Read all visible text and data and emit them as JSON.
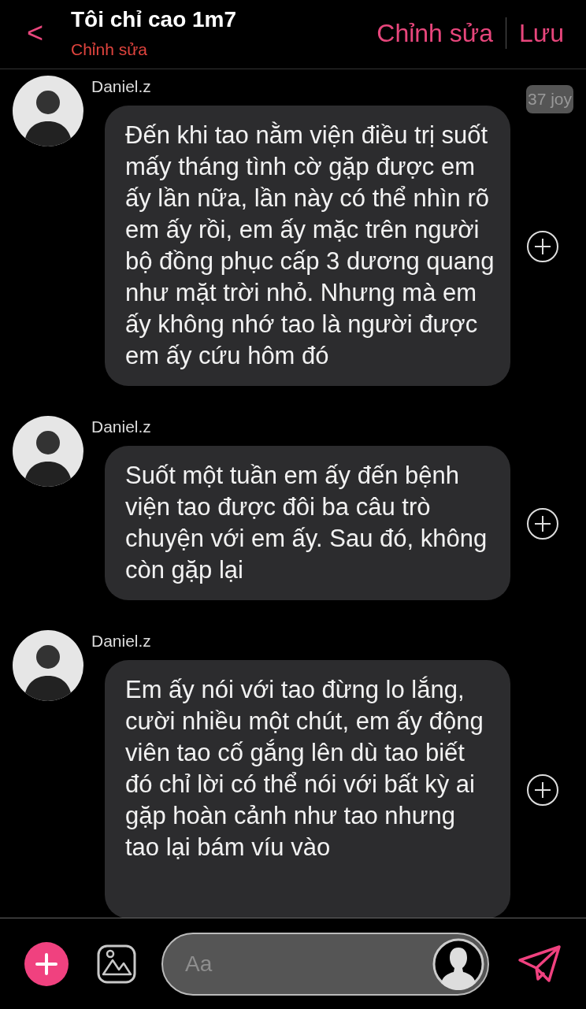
{
  "header": {
    "back": "<",
    "title": "Tôi chỉ cao 1m7",
    "subtitle": "Chỉnh sửa",
    "actions": [
      "Chỉnh sửa",
      "Lưu"
    ]
  },
  "messages": [
    {
      "sender": "Daniel.z",
      "badge": "37 joy",
      "text": "Đến khi tao nằm viện điều trị suốt mấy tháng tình cờ gặp được em ấy lần nữa, lần này có thể nhìn rõ em ấy rồi, em ấy mặc trên người bộ đồng phục cấp 3 dương quang như mặt trời nhỏ. Nhưng mà em ấy không nhớ tao là người được em ấy cứu hôm đó"
    },
    {
      "sender": "Daniel.z",
      "text": "Suốt một tuần em ấy đến bệnh viện tao được đôi ba câu trò chuyện với em ấy. Sau đó, không còn gặp lại"
    },
    {
      "sender": "Daniel.z",
      "text": "Em ấy nói với tao đừng lo lắng, cười nhiều một chút, em ấy động viên tao cố gắng lên dù tao biết đó chỉ lời có thể nói với bất kỳ ai gặp hoàn cảnh như tao nhưng tao lại bám víu vào"
    }
  ],
  "composer": {
    "placeholder": "Aa"
  }
}
